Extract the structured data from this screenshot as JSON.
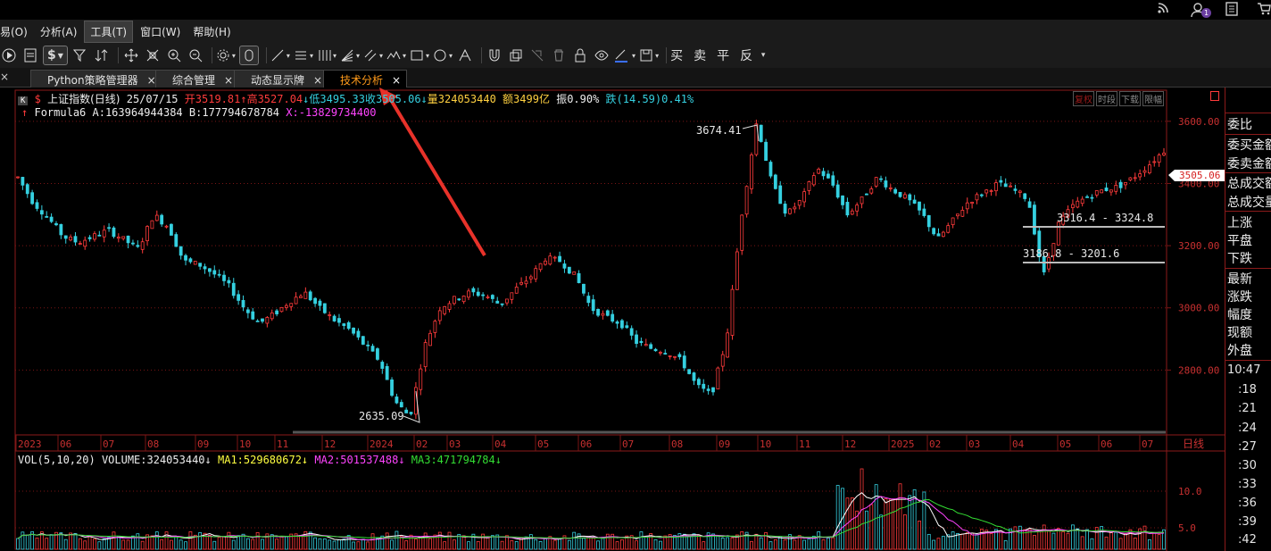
{
  "menu": [
    {
      "label": "易(O)",
      "active": false
    },
    {
      "label": "分析(A)",
      "active": false
    },
    {
      "label": "工具(T)",
      "active": true
    },
    {
      "label": "窗口(W)",
      "active": false
    },
    {
      "label": "帮助(H)",
      "active": false
    }
  ],
  "toolbar": {
    "dollar_label": "$",
    "trade_buttons": [
      "买",
      "卖",
      "平",
      "反"
    ]
  },
  "tabs": [
    {
      "label": "Python策略管理器",
      "close": "×",
      "active": false
    },
    {
      "label": "综合管理",
      "close": "×",
      "active": false
    },
    {
      "label": "动态显示牌",
      "close": "×",
      "active": false
    },
    {
      "label": "技术分析",
      "close": "×",
      "active": true
    }
  ],
  "titlebar": {
    "notification_badge": "1"
  },
  "quote": {
    "k_tag": "K",
    "symbol_prefix": "$",
    "name": "上证指数(日线)",
    "date": "25/07/15",
    "open": "开3519.81",
    "high": "高3527.04",
    "low": "低3495.33",
    "close": "收3505.06",
    "volume": "量324053440",
    "amount": "额3499亿",
    "amplitude": "振0.90%",
    "change": "跌(14.59)0.41%"
  },
  "formula": {
    "name": "Formula6",
    "a": "A:163964944384",
    "b": "B:177794678784",
    "x": "X:-13829734400"
  },
  "chart_controls": [
    "复权",
    "时段",
    "下载",
    "限幅"
  ],
  "chart_data": {
    "type": "line",
    "title": "上证指数(日线)",
    "y_ticks": [
      "3600.00",
      "3400.00",
      "3200.00",
      "3000.00",
      "2800.00"
    ],
    "ylim": [
      2600,
      3700
    ],
    "current_price": "3505.06",
    "annotations": [
      {
        "text": "3674.41",
        "x": "2024-10",
        "y": 3674.41
      },
      {
        "text": "2635.09",
        "x": "2024-02",
        "y": 2635.09
      },
      {
        "text": "3316.4 - 3324.8",
        "x": "2025-04",
        "y": 3320
      },
      {
        "text": "3186.8 - 3201.6",
        "x": "2025-04",
        "y": 3194
      }
    ],
    "x_ticks": [
      "2023",
      "06",
      "07",
      "08",
      "09",
      "10",
      "11",
      "12",
      "2024",
      "02",
      "03",
      "04",
      "05",
      "06",
      "07",
      "08",
      "09",
      "10",
      "11",
      "12",
      "2025",
      "02",
      "03",
      "04",
      "05",
      "06",
      "07"
    ],
    "x_axis_label": "日线",
    "series": [
      {
        "values": [
          3420,
          3340,
          3290,
          3230,
          3210,
          3230,
          3250,
          3220,
          3190,
          3300,
          3260,
          3150,
          3140,
          3110,
          3070,
          3000,
          2950,
          2980,
          3020,
          3050,
          3000,
          2960,
          2930,
          2880,
          2830,
          2700,
          2650,
          2880,
          3000,
          3030,
          3050,
          3040,
          3010,
          3060,
          3100,
          3160,
          3150,
          3100,
          3000,
          2970,
          2950,
          2890,
          2870,
          2860,
          2830,
          2750,
          2720,
          2900,
          3300,
          3600,
          3400,
          3300,
          3350,
          3450,
          3400,
          3300,
          3350,
          3420,
          3380,
          3350,
          3300,
          3220,
          3280,
          3340,
          3370,
          3400,
          3380,
          3350,
          3100,
          3270,
          3330,
          3360,
          3380,
          3390,
          3420,
          3460,
          3505
        ]
      }
    ]
  },
  "volume": {
    "label": "VOL(5,10,20)",
    "volume": "VOLUME:324053440",
    "ma1": "MA1:529680672",
    "ma2": "MA2:501537488",
    "ma3": "MA3:471794784",
    "y_ticks": [
      "10.0",
      "5.0"
    ]
  },
  "right_panel": {
    "labels": [
      "委比",
      "委买金额",
      "委卖金额",
      "总成交额",
      "总成交量",
      "上涨",
      "平盘",
      "下跌",
      "最新",
      "涨跌",
      "幅度",
      "现额",
      "外盘"
    ],
    "times": [
      "10:47",
      ":18",
      ":21",
      ":24",
      ":27",
      ":30",
      ":33",
      ":36",
      ":39",
      ":42"
    ]
  },
  "colors": {
    "up": "#ff3b3b",
    "down": "#35d0e0",
    "grid": "#7a1515",
    "ma1": "#ffffff",
    "ma2": "#ff44ff",
    "ma3": "#33dd33",
    "active_tab": "#ff9a1a",
    "arrow": "#e8322a"
  }
}
